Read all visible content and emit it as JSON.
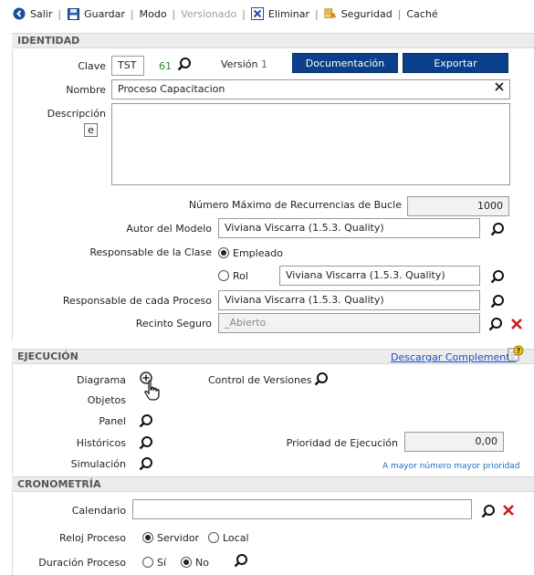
{
  "toolbar": {
    "salir": "Salir",
    "guardar": "Guardar",
    "modo": "Modo",
    "versionado": "Versionado",
    "eliminar": "Eliminar",
    "seguridad": "Seguridad",
    "cache": "Caché"
  },
  "identidad": {
    "header": "IDENTIDAD",
    "clave_label": "Clave",
    "clave_value": "TST",
    "clave_number": "61",
    "version_label": "Versión",
    "version_value": "1",
    "documentacion_button": "Documentación",
    "exportar_button": "Exportar",
    "nombre_label": "Nombre",
    "nombre_value": "Proceso Capacitacion",
    "descripcion_label": "Descripción",
    "descripcion_value": "",
    "max_recurrencias_label": "Número Máximo de Recurrencias de Bucle",
    "max_recurrencias_value": "1000",
    "autor_label": "Autor del Modelo",
    "autor_value": "Viviana Viscarra (1.5.3. Quality)",
    "responsable_clase_label": "Responsable de la Clase",
    "empleado_label": "Empleado",
    "rol_label": "Rol",
    "rol_value": "Viviana Viscarra (1.5.3. Quality)",
    "responsable_proceso_label": "Responsable de cada Proceso",
    "responsable_proceso_value": "Viviana Viscarra (1.5.3. Quality)",
    "recinto_label": "Recinto Seguro",
    "recinto_value": "_Abierto"
  },
  "ejecucion": {
    "header": "EJECUCIÓN",
    "descargar_link": "Descargar Complemento",
    "diagrama_label": "Diagrama",
    "objetos_label": "Objetos",
    "panel_label": "Panel",
    "historicos_label": "Históricos",
    "simulacion_label": "Simulación",
    "control_versiones_label": "Control de Versiones",
    "prioridad_label": "Prioridad de Ejecución",
    "prioridad_value": "0,00",
    "prioridad_hint": "A mayor número mayor prioridad"
  },
  "cronometria": {
    "header": "CRONOMETRÍA",
    "calendario_label": "Calendario",
    "calendario_value": "",
    "reloj_label": "Reloj Proceso",
    "servidor_label": "Servidor",
    "local_label": "Local",
    "duracion_label": "Duración Proceso",
    "si_label": "Sí",
    "no_label": "No"
  },
  "colors": {
    "button_blue": "#0b3f8a",
    "link_blue": "#1a4fc7",
    "green_value": "#2e8b2e",
    "remove_red": "#c81e1e"
  },
  "icons": [
    "circle-arrow-icon",
    "floppy-icon",
    "delete-x-icon",
    "security-keys-icon",
    "search-icon",
    "clear-x-icon",
    "red-x-icon",
    "edit-e-icon",
    "add-plus-icon",
    "hand-cursor-icon",
    "help-document-icon"
  ]
}
